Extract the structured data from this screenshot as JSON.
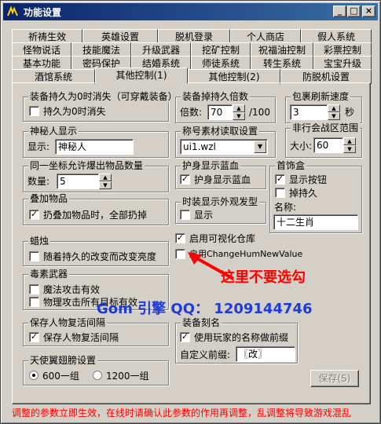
{
  "window": {
    "title": "功能设置",
    "controls": {
      "minimize": "_",
      "maximize": "□",
      "close": "×"
    }
  },
  "tabs": {
    "row1": [
      "祈祷生效",
      "英雄设置",
      "脱机登录",
      "个人商店",
      "假人系统"
    ],
    "row2": [
      "怪物说话",
      "技能魔法",
      "升级武器",
      "挖矿控制",
      "祝福油控制",
      "彩票控制"
    ],
    "row3": [
      "基本功能",
      "密码保护",
      "结婚系统",
      "师徒系统",
      "转生系统",
      "宝宝升级"
    ],
    "row4": [
      "酒馆系统",
      "其他控制(1)",
      "其他控制(2)",
      "防脱机设置"
    ],
    "active": "其他控制(1)"
  },
  "groups": {
    "durability_vanish": {
      "title": "装备持久为0时消失（可穿戴装备）",
      "option": {
        "label": "持久为0时消失",
        "checked": false
      }
    },
    "durability_multiplier": {
      "title": "装备掉持久倍数",
      "label": "倍数:",
      "value": "70",
      "suffix": "/100"
    },
    "package_refresh": {
      "title": "包裹刷新速度",
      "value": "3",
      "unit": "秒"
    },
    "mystery_display": {
      "title": "神秘人显示",
      "label": "显示:",
      "value": "神秘人"
    },
    "title_material": {
      "title": "称号素材读取设置",
      "selected": "ui1.wzl"
    },
    "non_pk_zone": {
      "title": "非行会战区范围",
      "label": "大小:",
      "value": "60"
    },
    "same_coord_drop": {
      "title": "同一坐标允许爆出物品数量",
      "label": "数量:",
      "value": "5"
    },
    "shield_mp": {
      "title": "护身显示蓝血",
      "option": {
        "label": "护身显示蓝血",
        "checked": true
      }
    },
    "accessory_box": {
      "title": "首饰盒",
      "show_button": {
        "label": "显示按钮",
        "checked": true
      },
      "durable": {
        "label": "掉持久",
        "checked": false
      },
      "name_label": "名称:",
      "name_value": "十二生肖"
    },
    "stack_items": {
      "title": "叠加物品",
      "option": {
        "label": "扔叠加物品时，全部扔掉",
        "checked": true
      }
    },
    "fashion_hair": {
      "title": "时装显示外观发型",
      "option": {
        "label": "显示",
        "checked": false
      }
    },
    "visual_warehouse": {
      "label": "启用可视化仓库",
      "checked": true
    },
    "change_hum": {
      "label": "启用ChangeHumNewValue",
      "checked": false
    },
    "candle": {
      "title": "蜡烛",
      "option": {
        "label": "随着持久的改变而改变亮度",
        "checked": false
      }
    },
    "poison_weapon": {
      "title": "毒素武器",
      "magic": {
        "label": "魔法攻击有效",
        "checked": false
      },
      "physical": {
        "label": "物理攻击所有目标有效",
        "checked": false
      }
    },
    "save_revive": {
      "title": "保存人物复活间隔",
      "option": {
        "label": "保存人物复活间隔",
        "checked": true
      }
    },
    "equip_engrave": {
      "title": "装备刻名",
      "option": {
        "label": "使用玩家的名称做前缀",
        "checked": true
      },
      "prefix_label": "自定义前缀:",
      "prefix_value": "〖改〗"
    },
    "angel_wings": {
      "title": "天使翼翅膀设置",
      "opt1": {
        "label": "600一组",
        "checked": true
      },
      "opt2": {
        "label": "1200一组",
        "checked": false
      }
    }
  },
  "save_button": "保存(S)",
  "annotations": {
    "warning": "这里不要选勾",
    "watermark": "Gom 引擎 QQ： 1209144746"
  },
  "footer_note": "调整的参数立即生效，在线时请确认此参数的作用再调整，乱调整将导致游戏混乱",
  "colors": {
    "title_start": "#0a246a",
    "title_end": "#3a6ea5",
    "warning": "#ff0000",
    "watermark": "#1f3bd6"
  }
}
